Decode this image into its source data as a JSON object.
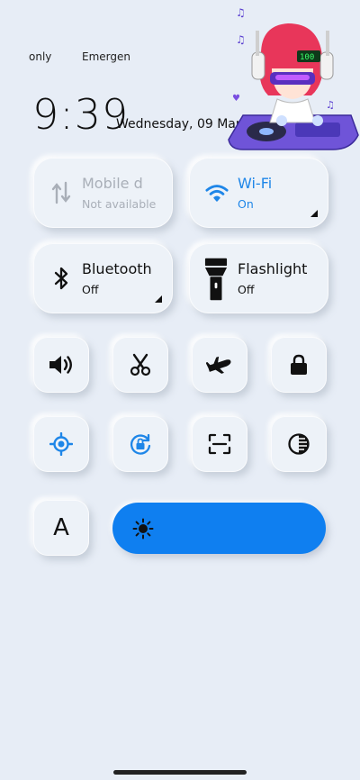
{
  "status": {
    "left_text": "only",
    "right_text": "Emergen"
  },
  "clock": {
    "time": "9:39",
    "date": "Wednesday, 09 March"
  },
  "tiles": {
    "mobile_data": {
      "title": "Mobile d",
      "state": "Not available"
    },
    "wifi": {
      "title": "Wi-Fi",
      "state": "On"
    },
    "bluetooth": {
      "title": "Bluetooth",
      "state": "Off"
    },
    "flashlight": {
      "title": "Flashlight",
      "state": "Off"
    }
  },
  "small_tiles": {
    "row1": [
      "sound-icon",
      "scissors-icon",
      "airplane-icon",
      "lock-icon"
    ],
    "row2": [
      "location-icon",
      "auto-rotate-icon",
      "scan-icon",
      "contrast-icon"
    ]
  },
  "font_tile": {
    "label": "A"
  },
  "brightness": {
    "icon": "sun-icon"
  },
  "sticker": {
    "badge": "100"
  },
  "colors": {
    "accent": "#1e86e8",
    "slider": "#0f7ff0",
    "background": "#e7edf6"
  }
}
